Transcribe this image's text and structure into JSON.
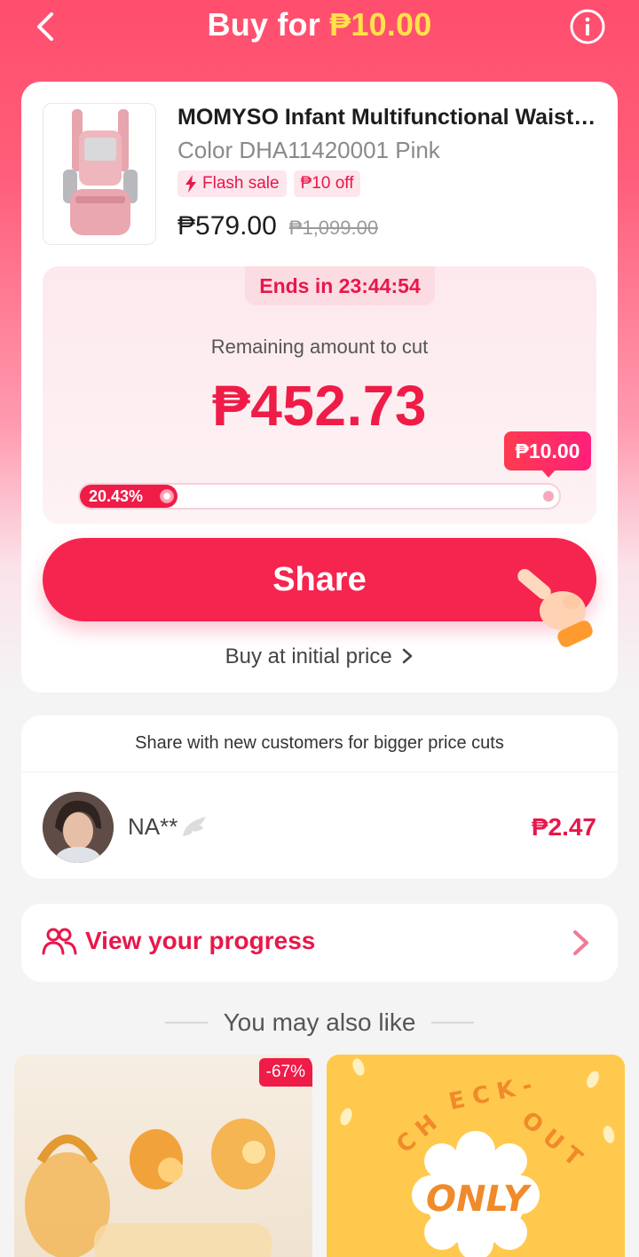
{
  "header": {
    "title_prefix": "Buy for ",
    "title_price": "₱10.00"
  },
  "product": {
    "title": "MOMYSO Infant Multifunctional Waist…",
    "variant": "Color DHA11420001 Pink",
    "tags": [
      "Flash sale",
      "₱10 off"
    ],
    "price": "₱579.00",
    "original_price": "₱1,099.00"
  },
  "cut": {
    "ends_in": "Ends in 23:44:54",
    "remaining_label": "Remaining amount to cut",
    "remaining_amount": "₱452.73",
    "target_price": "₱10.00",
    "progress_label": "20.43%",
    "progress_fraction": 0.2043
  },
  "actions": {
    "share_label": "Share",
    "buy_initial_label": "Buy at initial price"
  },
  "helpers": {
    "hint": "Share with new customers for bigger price cuts",
    "items": [
      {
        "name": "NA**",
        "amount": "₱2.47"
      }
    ]
  },
  "progress_link": {
    "label": "View your progress"
  },
  "recommendations": {
    "title": "You may also like",
    "items": [
      {
        "discount": "-67%"
      },
      {
        "discount": ""
      }
    ]
  },
  "colors": {
    "accent": "#ee1c47",
    "header_gradient": "#ff4d6d",
    "price_highlight": "#ffe14a"
  },
  "icons": [
    "back-arrow-icon",
    "info-icon",
    "bolt-icon",
    "pointing-hand-icon",
    "wing-icon",
    "people-icon",
    "chevron-right-icon"
  ]
}
